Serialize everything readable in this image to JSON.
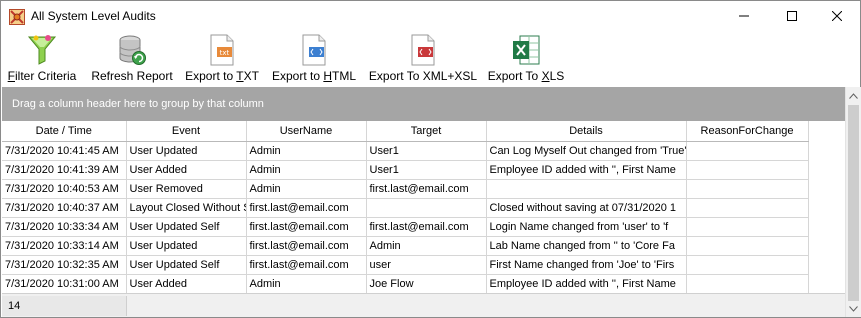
{
  "window": {
    "title": "All System Level Audits",
    "icons": {
      "app": "app-logo-icon",
      "minimize": "minimize-icon",
      "maximize": "maximize-icon",
      "close": "close-icon"
    }
  },
  "toolbar": {
    "filter_pre": "F",
    "filter_post": "ilter Criteria",
    "filter_icon": "funnel-icon",
    "refresh_label": "Refresh Report",
    "refresh_icon": "database-refresh-icon",
    "txt_pre": "Export to ",
    "txt_ul": "T",
    "txt_post": "XT",
    "txt_icon": "txt-file-icon",
    "html_pre": "Export to ",
    "html_ul": "H",
    "html_post": "TML",
    "html_icon": "html-file-icon",
    "xml_label": "Export To XML+XSL",
    "xml_icon": "xml-file-icon",
    "xls_pre": "Export To ",
    "xls_ul": "X",
    "xls_post": "LS",
    "xls_icon": "excel-file-icon"
  },
  "group_panel": {
    "hint": "Drag a column header here to group by that column"
  },
  "table": {
    "columns": [
      "Date / Time",
      "Event",
      "UserName",
      "Target",
      "Details",
      "ReasonForChange"
    ],
    "rows": [
      [
        "7/31/2020 10:41:45 AM",
        "User Updated",
        "Admin",
        "User1",
        "Can Log Myself Out changed from 'True'",
        ""
      ],
      [
        "7/31/2020 10:41:39 AM",
        "User Added",
        "Admin",
        "User1",
        "Employee ID added with '', First Name",
        ""
      ],
      [
        "7/31/2020 10:40:53 AM",
        "User Removed",
        "Admin",
        "first.last@email.com",
        "",
        ""
      ],
      [
        "7/31/2020 10:40:37 AM",
        "Layout Closed Without Saving",
        "first.last@email.com",
        "",
        "Closed without saving at 07/31/2020 1",
        ""
      ],
      [
        "7/31/2020 10:33:34 AM",
        "User Updated Self",
        "first.last@email.com",
        "first.last@email.com",
        "Login Name changed from 'user' to 'f",
        ""
      ],
      [
        "7/31/2020 10:33:14 AM",
        "User Updated",
        "first.last@email.com",
        "Admin",
        "Lab Name changed from '' to 'Core Fa",
        ""
      ],
      [
        "7/31/2020 10:32:35 AM",
        "User Updated Self",
        "first.last@email.com",
        "user",
        "First Name changed from 'Joe' to 'Firs",
        ""
      ],
      [
        "7/31/2020 10:31:00 AM",
        "User Added",
        "Admin",
        "Joe Flow",
        "Employee ID added with '', First Name",
        ""
      ]
    ]
  },
  "footer": {
    "count": "14"
  }
}
